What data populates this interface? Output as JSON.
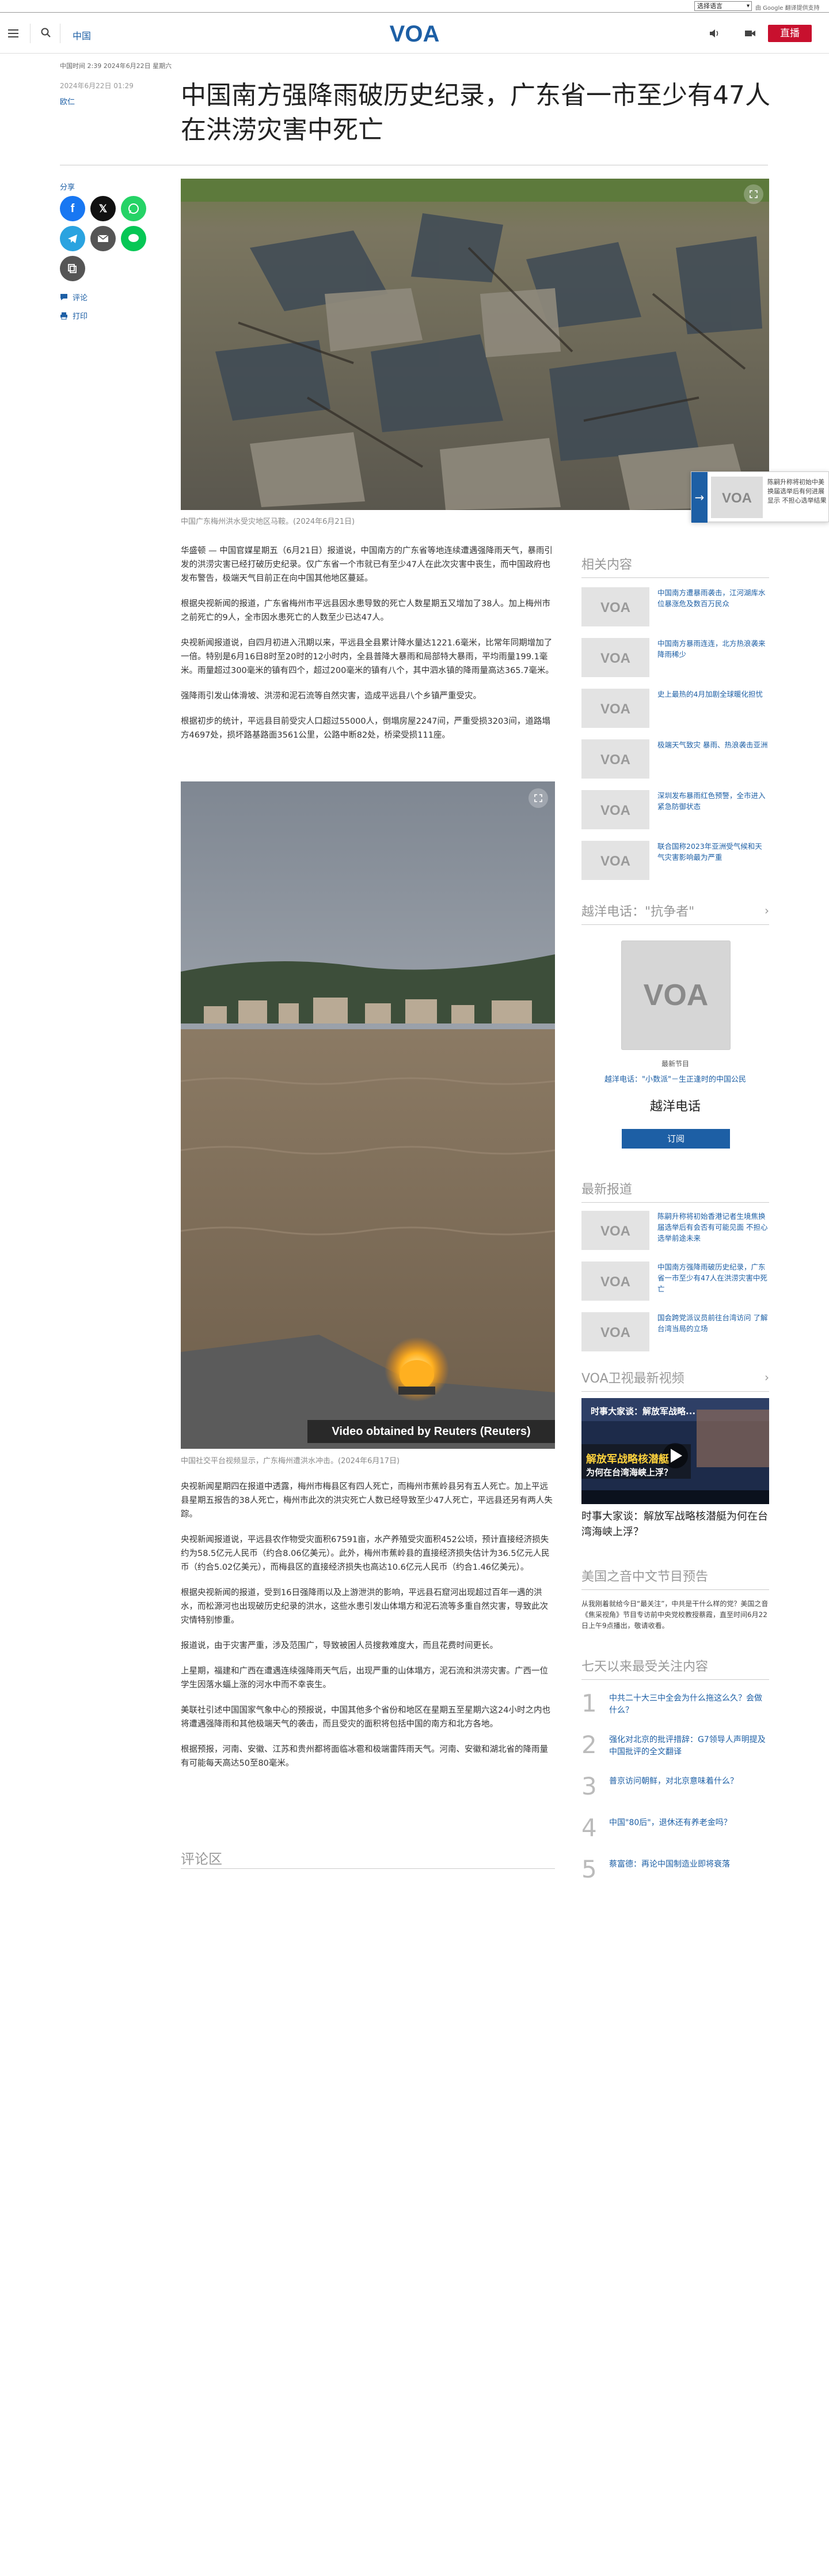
{
  "translate": {
    "select_label": "选择语言",
    "powered_by": "由 Google 翻译提供支持"
  },
  "header": {
    "section": "中国",
    "logo_text": "VOA",
    "live_label": "直播"
  },
  "article": {
    "meta_top": "中国时间 2:39 2024年6月22日 星期六",
    "date": "2024年6月22日 01:29",
    "author": "欧仁",
    "title": "中国南方强降雨破历史纪录，广东省一市至少有47人在洪涝灾害中死亡",
    "hero_caption": "中国广东梅州洪水受灾地区马鞍。(2024年6月21日)",
    "paragraphs_a": [
      "华盛顿 — 中国官媒星期五（6月21日）报道说，中国南方的广东省等地连续遭遇强降雨天气，暴雨引发的洪涝灾害已经打破历史纪录。仅广东省一个市就已有至少47人在此次灾害中丧生，而中国政府也发布警告，极端天气目前正在向中国其他地区蔓延。",
      "根据央视新闻的报道，广东省梅州市平远县因水患导致的死亡人数星期五又增加了38人。加上梅州市之前死亡的9人，全市因水患死亡的人数至少已达47人。",
      "央视新闻报道说，自四月初进入汛期以来，平远县全县累计降水量达1221.6毫米，比常年同期增加了一倍。特别是6月16日8时至20时的12小时内，全县普降大暴雨和局部特大暴雨，平均雨量199.1毫米。雨量超过300毫米的镇有四个，超过200毫米的镇有八个，其中泗水镇的降雨量高达365.7毫米。",
      "强降雨引发山体滑坡、洪涝和泥石流等自然灾害，造成平远县八个乡镇严重受灾。",
      "根据初步的统计，平远县目前受灾人口超过55000人，倒塌房屋2247间，严重受损3203间，道路塌方4697处，损坏路基路面3561公里，公路中断82处，桥梁受损111座。"
    ],
    "video_caption": "中国社交平台视频显示，广东梅州遭洪水冲击。(2024年6月17日)",
    "video_overlay": "Video obtained by Reuters (Reuters)",
    "paragraphs_b": [
      "央视新闻星期四在报道中透露，梅州市梅县区有四人死亡，而梅州市蕉岭县另有五人死亡。加上平远县星期五报告的38人死亡，梅州市此次的洪灾死亡人数已经导致至少47人死亡，平远县还另有两人失踪。",
      "央视新闻报道说，平远县农作物受灾面积67591亩，水产养殖受灾面积452公顷，预计直接经济损失约为58.5亿元人民币（约合8.06亿美元）。此外，梅州市蕉岭县的直接经济损失估计为36.5亿元人民币（约合5.02亿美元），而梅县区的直接经济损失也高达10.6亿元人民币（约合1.46亿美元）。",
      "根据央视新闻的报道，受到16日强降雨以及上游泄洪的影响，平远县石窟河出现超过百年一遇的洪水，而松源河也出现破历史纪录的洪水，这些水患引发山体塌方和泥石流等多重自然灾害，导致此次灾情特别惨重。",
      "报道说，由于灾害严重，涉及范围广，导致被困人员搜救难度大，而且花费时间更长。",
      "上星期，福建和广西在遭遇连续强降雨天气后，出现严重的山体塌方，泥石流和洪涝灾害。广西一位学生因落水蝠上涨的河水中而不幸丧生。",
      "美联社引述中国国家气象中心的预报说，中国其他多个省份和地区在星期五至星期六这24小时之内也将遭遇强降雨和其他极端天气的袭击，而且受灾的面积将包括中国的南方和北方各地。",
      "根据预报，河南、安徽、江苏和贵州都将面临冰雹和极端雷阵雨天气。河南、安徽和湖北省的降雨量有可能每天高达50至80毫米。"
    ],
    "comments_heading": "评论区"
  },
  "share": {
    "label": "分享",
    "comment": "评论",
    "print": "打印"
  },
  "float_promo": {
    "text": "陈嗣升称将初始中美换届选举后有何进展显示 不担心选举结果"
  },
  "sidebar": {
    "related": {
      "heading": "相关内容",
      "items": [
        "中国南方遭暴雨袭击，江河湖库水位暴涨危及数百万民众",
        "中国南方暴雨连连，北方热浪袭来降雨稀少",
        "史上最热的4月加剧全球暖化担忧",
        "极端天气致灾 暴雨、热浪袭击亚洲",
        "深圳发布暴雨红色预警，全市进入紧急防御状态",
        "联合国称2023年亚洲受气候和天气灾害影响最为严重"
      ]
    },
    "podcast": {
      "heading": "越洋电话：\"抗争者\"",
      "newest": "最新节目",
      "episode": "越洋电话：\"小数派\"－生正逢时的中国公民",
      "name": "越洋电话",
      "subscribe": "订阅"
    },
    "latest": {
      "heading": "最新报道",
      "items": [
        "陈嗣升称将初始香港记者生境焦换届选举后有会否有可能见面 不担心选举前途未来",
        "中国南方强降雨破历史纪录，广东省一市至少有47人在洪涝灾害中死亡",
        "国会跨党派议员前往台湾访问 了解台湾当局的立场"
      ]
    },
    "video": {
      "heading": "VOA卫视最新视频",
      "title": "时事大家谈：解放军战略核潜艇为何在台湾海峡上浮？",
      "overlay_line1": "时事大家谈：解放军战略...",
      "overlay_line2": "解放军战略核潜艇",
      "overlay_line3": "为何在台湾海峡上浮？"
    },
    "program": {
      "heading": "美国之音中文节目预告",
      "text": "从我刚着就给今日“最关注”，中共是干什么样的党？美国之音《焦采视角》节目专访前中央党校教授蔡霞，直至时间6月22日上午9点播出，敬请收看。"
    },
    "popular": {
      "heading": "七天以来最受关注内容",
      "items": [
        {
          "num": "1",
          "text": "中共二十大三中全会为什么拖这么久？会做什么？"
        },
        {
          "num": "2",
          "text": "强化对北京的批评措辞：G7领导人声明提及中国批评的全文翻译"
        },
        {
          "num": "3",
          "text": "普京访问朝鲜，对北京意味着什么？"
        },
        {
          "num": "4",
          "text": "中国\"80后\"，退休还有养老金吗？"
        },
        {
          "num": "5",
          "text": "蔡富德：再论中国制造业即将衰落"
        }
      ]
    }
  },
  "colors": {
    "brand_blue": "#1d5fa5",
    "live_red": "#c8102e"
  }
}
